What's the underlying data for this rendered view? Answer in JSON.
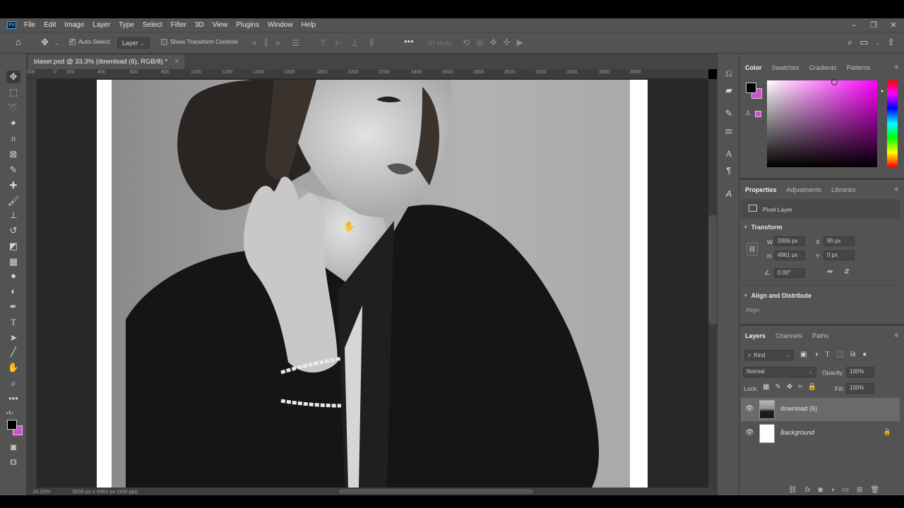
{
  "app": {
    "logo": "Ps",
    "menus": [
      "File",
      "Edit",
      "Image",
      "Layer",
      "Type",
      "Select",
      "Filter",
      "3D",
      "View",
      "Plugins",
      "Window",
      "Help"
    ]
  },
  "options": {
    "auto_select_label": "Auto-Select:",
    "auto_select_target": "Layer",
    "show_transform_label": "Show Transform Controls",
    "mode_3d_label": "3D Mode:"
  },
  "document": {
    "tab_title": "blaser.psd @ 33.3% (download (6), RGB/8) *",
    "close_glyph": "×",
    "zoom": "33.33%",
    "doc_size": "3508 px x 4961 px (300 ppi)"
  },
  "ruler": {
    "labels": [
      "200",
      "0",
      "200",
      "400",
      "600",
      "800",
      "1000",
      "1200",
      "1400",
      "1600",
      "1800",
      "2000",
      "2200",
      "2400",
      "2600",
      "2800",
      "3000",
      "3200",
      "3400",
      "3600",
      "3800"
    ]
  },
  "color_panel": {
    "tabs": [
      "Color",
      "Swatches",
      "Gradients",
      "Patterns"
    ],
    "foreground": "#000000",
    "background": "#d14fd0"
  },
  "properties_panel": {
    "tabs": [
      "Properties",
      "Adjustments",
      "Libraries"
    ],
    "layer_type": "Pixel Layer",
    "transform_title": "Transform",
    "w_label": "W",
    "w_value": "3306 px",
    "h_label": "H",
    "h_value": "4961 px",
    "x_label": "X",
    "x_value": "95 px",
    "y_label": "Y",
    "y_value": "0 px",
    "angle_value": "0.00°",
    "align_title": "Align and Distribute",
    "align_label": "Align:"
  },
  "layers_panel": {
    "tabs": [
      "Layers",
      "Channels",
      "Paths"
    ],
    "filter_kind": "Kind",
    "blend_mode": "Normal",
    "opacity_label": "Opacity:",
    "opacity_value": "100%",
    "lock_label": "Lock:",
    "fill_label": "Fill:",
    "fill_value": "100%",
    "layers": [
      {
        "name": "download (6)",
        "selected": true
      },
      {
        "name": "Background",
        "selected": false,
        "locked": true
      }
    ]
  },
  "colors": {
    "ui_bg": "#535353",
    "panel_dark": "#3d3d3d",
    "accent_ps": "#31a8ff",
    "bg_color": "#d14fd0"
  }
}
